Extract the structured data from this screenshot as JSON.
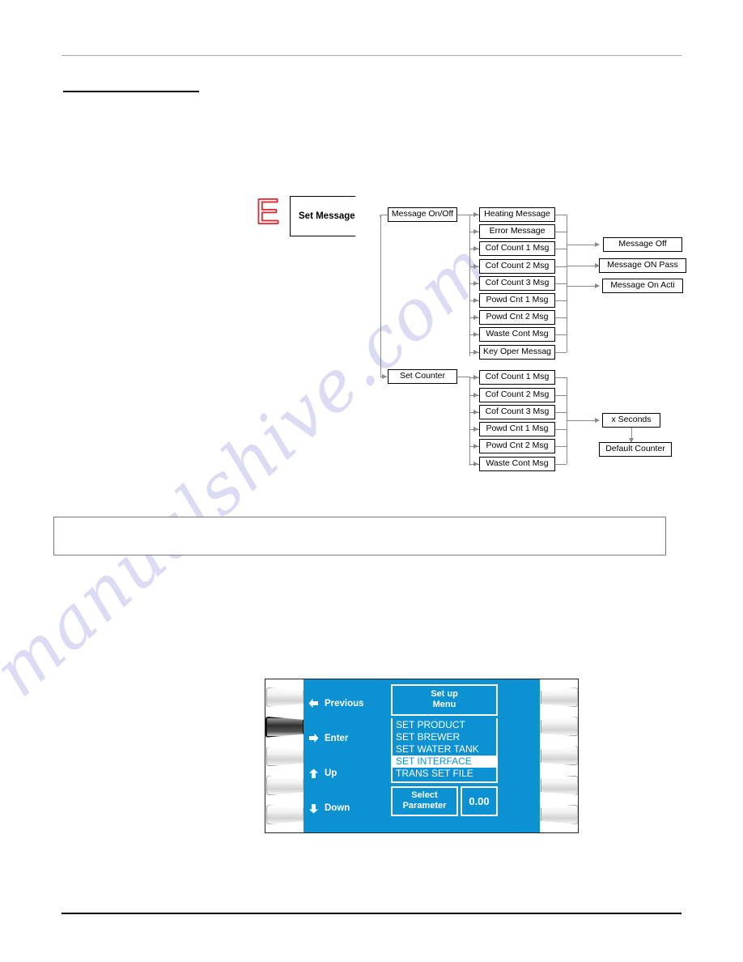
{
  "page": {
    "heading": "",
    "watermark": "manualshive.com",
    "note_box_text": ""
  },
  "diagram": {
    "logo_letter": "E",
    "root": "Set Message",
    "level1": [
      {
        "label": "Message On/Off"
      },
      {
        "label": "Set Counter"
      }
    ],
    "message_on_off_children": [
      "Heating Message",
      "Error Message",
      "Cof Count 1 Msg",
      "Cof Count 2 Msg",
      "Cof Count 3 Msg",
      "Powd Cnt 1 Msg",
      "Powd Cnt 2 Msg",
      "Waste Cont Msg",
      "Key Oper Messag"
    ],
    "message_states": [
      "Message Off",
      "Message ON Pass",
      "Message On Acti"
    ],
    "set_counter_children": [
      "Cof Count 1 Msg",
      "Cof Count 2 Msg",
      "Cof Count 3 Msg",
      "Powd Cnt 1 Msg",
      "Powd Cnt 2 Msg",
      "Waste Cont Msg"
    ],
    "counter_values": [
      "x Seconds",
      "Default Counter"
    ]
  },
  "panel": {
    "keys": [
      {
        "label": "Previous",
        "icon": "arrow-left-icon"
      },
      {
        "label": "Enter",
        "icon": "arrow-right-icon"
      },
      {
        "label": "Up",
        "icon": "arrow-up-icon"
      },
      {
        "label": "Down",
        "icon": "arrow-down-icon"
      }
    ],
    "screen": {
      "title_line1": "Set up",
      "title_line2": "Menu",
      "items": [
        {
          "label": "SET PRODUCT",
          "selected": false
        },
        {
          "label": "SET BREWER",
          "selected": false
        },
        {
          "label": "SET WATER TANK",
          "selected": false
        },
        {
          "label": "SET INTERFACE",
          "selected": true
        },
        {
          "label": "TRANS SET FILE",
          "selected": false
        }
      ],
      "footer_label_line1": "Select",
      "footer_label_line2": "Parameter",
      "footer_value": "0.00"
    },
    "left_buttons": [
      {
        "pressed": false
      },
      {
        "pressed": true
      },
      {
        "pressed": false
      },
      {
        "pressed": false
      },
      {
        "pressed": false
      }
    ],
    "right_buttons": [
      {
        "pressed": false
      },
      {
        "pressed": false
      },
      {
        "pressed": false
      },
      {
        "pressed": false
      },
      {
        "pressed": false
      }
    ],
    "colors": {
      "lcd_blue": "#0c92d2",
      "lcd_text": "#ffffff",
      "selected_text": "#0c92d2"
    }
  }
}
